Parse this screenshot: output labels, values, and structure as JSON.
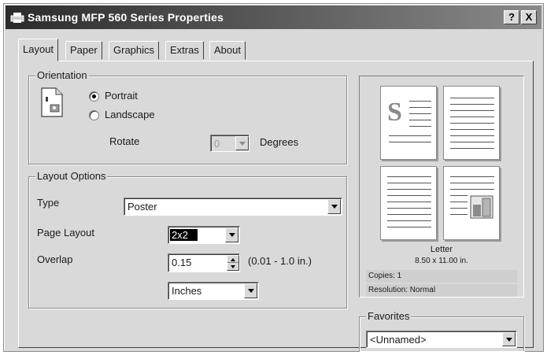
{
  "window": {
    "title": "Samsung MFP 560 Series Properties",
    "help_label": "?",
    "close_label": "X"
  },
  "tabs": [
    {
      "label": "Layout"
    },
    {
      "label": "Paper"
    },
    {
      "label": "Graphics"
    },
    {
      "label": "Extras"
    },
    {
      "label": "About"
    }
  ],
  "orientation": {
    "legend": "Orientation",
    "portrait_label": "Portrait",
    "landscape_label": "Landscape",
    "selected": "portrait",
    "rotate_label": "Rotate",
    "rotate_value": "0",
    "degrees_label": "Degrees"
  },
  "layout_options": {
    "legend": "Layout Options",
    "type_label": "Type",
    "type_value": "Poster",
    "page_layout_label": "Page Layout",
    "page_layout_value": "2x2",
    "overlap_label": "Overlap",
    "overlap_value": "0.15",
    "overlap_range": "(0.01 - 1.0 in.)",
    "unit_value": "Inches"
  },
  "preview": {
    "logo_letter": "S",
    "paper_name": "Letter",
    "paper_size": "8.50 x 11.00 in.",
    "copies": "Copies: 1",
    "resolution": "Resolution: Normal"
  },
  "favorites": {
    "legend": "Favorites",
    "value": "<Unnamed>"
  },
  "colors": {
    "face": "#d9d9d9",
    "shadow": "#404040",
    "highlight": "#ffffff",
    "selection": "#000000"
  }
}
